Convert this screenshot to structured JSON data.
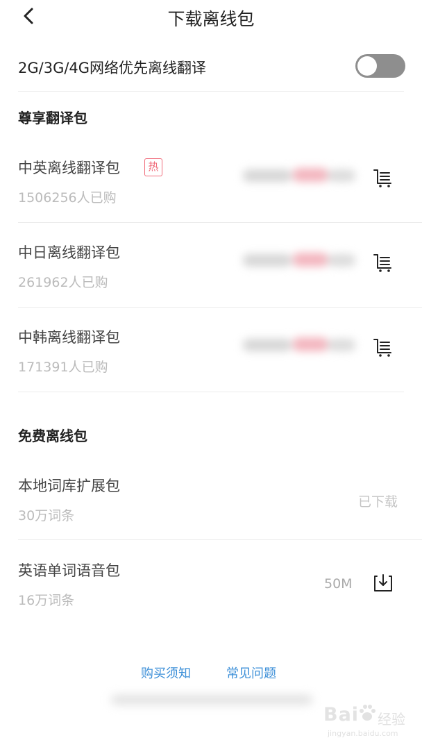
{
  "header": {
    "title": "下载离线包"
  },
  "settings": {
    "network_toggle_label": "2G/3G/4G网络优先离线翻译",
    "network_toggle_on": false
  },
  "premium": {
    "section_title": "尊享翻译包",
    "hot_badge": "热",
    "items": [
      {
        "name": "中英离线翻译包",
        "purchased": "1506256人已购",
        "hot": true
      },
      {
        "name": "中日离线翻译包",
        "purchased": "261962人已购",
        "hot": false
      },
      {
        "name": "中韩离线翻译包",
        "purchased": "171391人已购",
        "hot": false
      }
    ]
  },
  "free": {
    "section_title": "免费离线包",
    "items": [
      {
        "name": "本地词库扩展包",
        "sub": "30万词条",
        "status": "已下载"
      },
      {
        "name": "英语单词语音包",
        "sub": "16万词条",
        "size": "50M"
      }
    ]
  },
  "footer": {
    "links": [
      "购买须知",
      "常见问题"
    ]
  },
  "watermark": {
    "main": "Bai",
    "cn": "经验",
    "sub": "jingyan.baidu.com"
  },
  "colors": {
    "toggle_off": "#8e8e8e",
    "hot": "#f06b7a",
    "link": "#3c8fd8",
    "muted": "#bbbbbb"
  },
  "icons": [
    "back-arrow-icon",
    "cart-icon",
    "download-icon",
    "baidu-paw-icon"
  ]
}
